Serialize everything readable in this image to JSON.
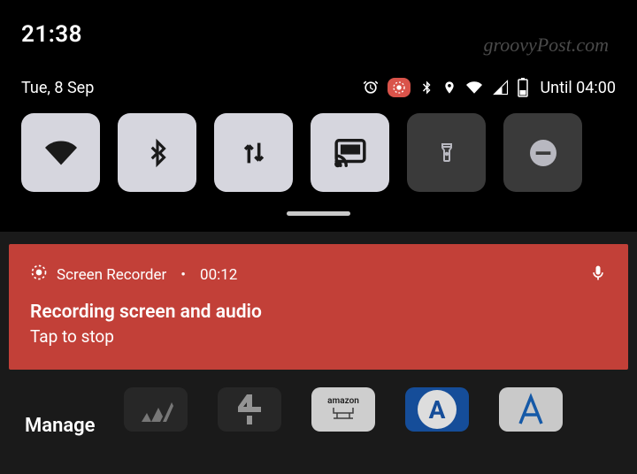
{
  "clock": "21:38",
  "date": "Tue, 8 Sep",
  "until_label": "Until 04:00",
  "watermark": "groovyPost.com",
  "quick_tiles": [
    {
      "name": "wifi",
      "on": true
    },
    {
      "name": "bluetooth",
      "on": true
    },
    {
      "name": "data",
      "on": true
    },
    {
      "name": "cast",
      "on": true
    },
    {
      "name": "flashlight",
      "on": false
    },
    {
      "name": "dnd",
      "on": false
    }
  ],
  "status_icons": [
    "alarm",
    "screen-record",
    "bluetooth",
    "location",
    "wifi",
    "signal",
    "battery"
  ],
  "notification": {
    "app": "Screen Recorder",
    "separator": "•",
    "time": "00:12",
    "title": "Recording screen and audio",
    "subtitle": "Tap to stop"
  },
  "manage_label": "Manage",
  "colors": {
    "accent_red": "#c24038",
    "tile_on": "#d6d6de",
    "tile_off": "#3a3a3a"
  }
}
